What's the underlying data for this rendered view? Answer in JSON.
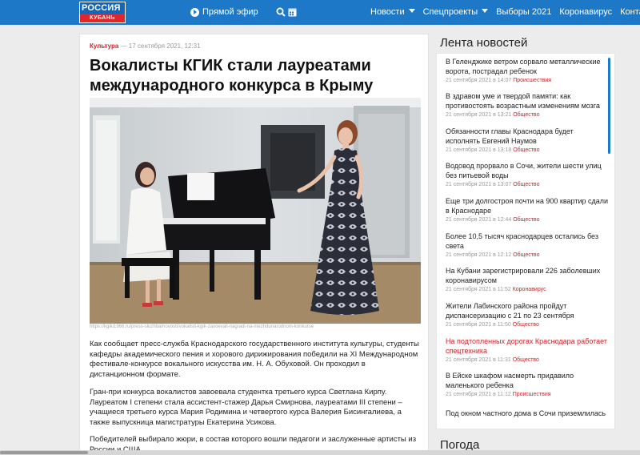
{
  "header": {
    "logo_top": "РОССИЯ",
    "logo_bottom": "КУБАНЬ",
    "live_label": "Прямой эфир",
    "icons": [
      "play-icon",
      "search-icon",
      "calendar-icon",
      "chevron-down-icon"
    ],
    "nav": [
      "Новости",
      "Спецпроекты",
      "Выборы 2021",
      "Коронавирус",
      "Контакты"
    ],
    "colors": {
      "brand": "#1e78c8",
      "accent": "#c8242b"
    }
  },
  "article": {
    "category": "Культура",
    "date": "— 17 сентября 2021, 12:31",
    "title": "Вокалисты КГИК стали лауреатами международного конкурса в Крыму",
    "image_credit": "https://kgiki1966.ru/press-sluzhba/novosti/vokalisti-kgik-zavoevali-nagradi-na-mezhdunarodnom-konkurse",
    "paragraphs": [
      "Как сообщает пресс-служба Краснодарского государственного института культуры, студенты кафедры академического пения и хорового дирижирования победили на XI Международном фестивале-конкурсе вокального искусства им. Н. А. Обуховой. Он проходил в дистанционном формате.",
      "Гран-при конкурса вокалистов завоевала студентка третьего курса Светлана Кирпу. Лауреатом I степени стала ассистент-стажер Дарья Смирнова, лауреатами III степени – учащиеся третьего курса Мария Родимина и четвертого курса Валерия Бисингалиева, а также выпускница магистратуры Екатерина Усикова.",
      "Победителей выбирало жюри, в состав которого вошли педагоги и заслуженные артисты из России и США."
    ]
  },
  "sidebar": {
    "title": "Лента новостей",
    "news": [
      {
        "title": "В Геленджике ветром сорвало металлические ворота, пострадал ребенок",
        "time": "21 сентября 2021 в 14:07",
        "category": "Происшествия",
        "highlight": false
      },
      {
        "title": "В здравом уме и твердой памяти: как противостоять возрастным изменениям мозга",
        "time": "21 сентября 2021 в 13:21",
        "category": "Общество",
        "highlight": false
      },
      {
        "title": "Обязанности главы Краснодара будет исполнять Евгений Наумов",
        "time": "21 сентября 2021 в 13:18",
        "category": "Общество",
        "highlight": false
      },
      {
        "title": "Водовод прорвало в Сочи, жители шести улиц без питьевой воды",
        "time": "21 сентября 2021 в 13:07",
        "category": "Общество",
        "highlight": false
      },
      {
        "title": "Еще три долгостроя почти на 900 квартир сдали в Краснодаре",
        "time": "21 сентября 2021 в 12:44",
        "category": "Общество",
        "highlight": false
      },
      {
        "title": "Более 10,5 тысяч краснодарцев остались без света",
        "time": "21 сентября 2021 в 12:12",
        "category": "Общество",
        "highlight": false
      },
      {
        "title": "На Кубани зарегистрировали 226 заболевших коронавирусом",
        "time": "21 сентября 2021 в 11:52",
        "category": "Коронавирус",
        "highlight": false
      },
      {
        "title": "Жители Лабинского района пройдут диспансеризацию с 21 по 23 сентября",
        "time": "21 сентября 2021 в 11:50",
        "category": "Общество",
        "highlight": false
      },
      {
        "title": "На подтопленных дорогах Краснодара работает спецтехника",
        "time": "21 сентября 2021 в 11:31",
        "category": "Общество",
        "highlight": true
      },
      {
        "title": "В Ейске шкафом насмерть придавило маленького ребенка",
        "time": "21 сентября 2021 в 11:12",
        "category": "Происшествия",
        "highlight": false
      },
      {
        "title": "Под окном частного дома в Сочи приземлилась",
        "time": "",
        "category": "",
        "highlight": false
      }
    ],
    "weather_title": "Погода"
  }
}
